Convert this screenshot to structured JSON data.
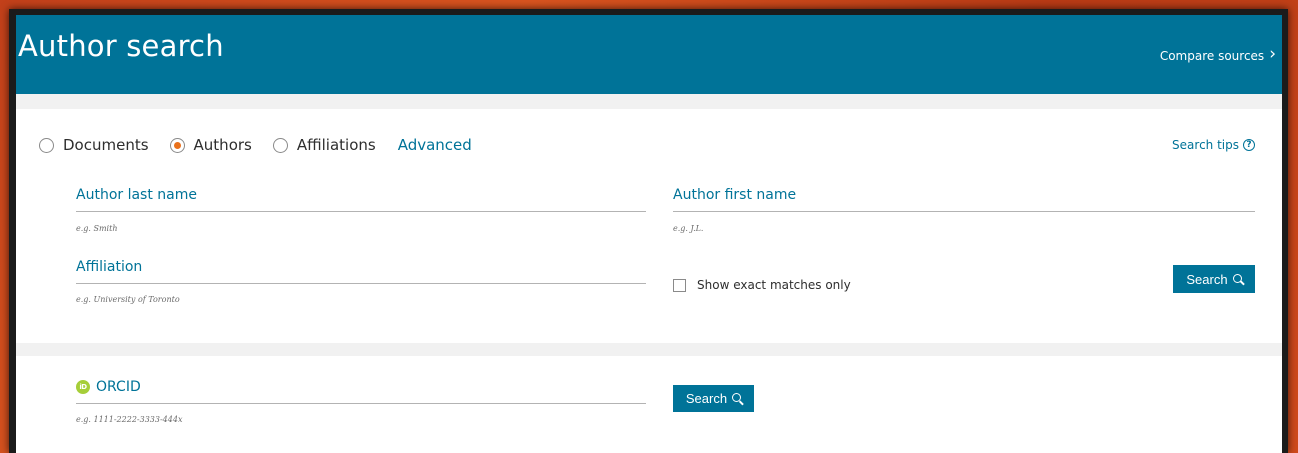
{
  "header": {
    "title": "Author search",
    "compare_label": "Compare sources"
  },
  "search_type": {
    "options": [
      "Documents",
      "Authors",
      "Affiliations"
    ],
    "selected": "Authors",
    "advanced_label": "Advanced"
  },
  "search_tips_label": "Search tips",
  "fields": {
    "last_name": {
      "label": "Author last name",
      "value": "",
      "hint": "e.g. Smith"
    },
    "first_name": {
      "label": "Author first name",
      "value": "",
      "hint": "e.g. J.L."
    },
    "affiliation": {
      "label": "Affiliation",
      "value": "",
      "hint": "e.g. University of Toronto"
    }
  },
  "exact_matches_label": "Show exact matches only",
  "exact_matches_checked": false,
  "search_button_label": "Search",
  "orcid": {
    "label": "ORCID",
    "logo_text": "iD",
    "value": "",
    "hint": "e.g. 1111-2222-3333-444x",
    "search_button_label": "Search"
  },
  "colors": {
    "brand": "#007398",
    "radio_selected": "#e9711c",
    "orcid_green": "#a6ce39",
    "background_border": "#c2401a"
  }
}
